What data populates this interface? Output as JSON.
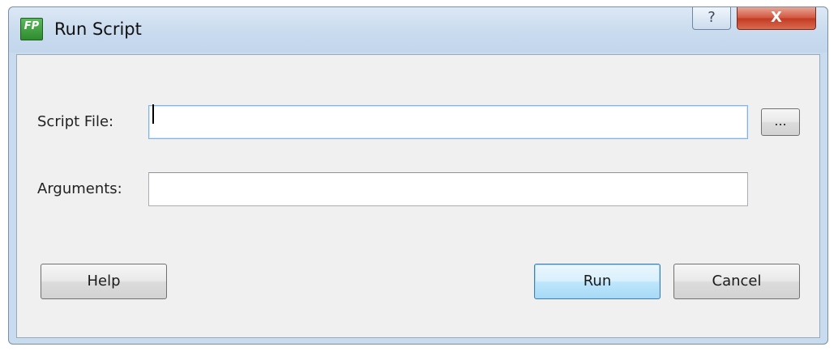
{
  "window": {
    "title": "Run Script",
    "app_icon": {
      "name": "fp-app-icon",
      "text": "FP"
    },
    "help_glyph": "?",
    "close_glyph": "X"
  },
  "form": {
    "script_file": {
      "label": "Script File:",
      "value": "",
      "browse_label": "..."
    },
    "arguments": {
      "label": "Arguments:",
      "value": ""
    }
  },
  "buttons": {
    "help": "Help",
    "run": "Run",
    "cancel": "Cancel"
  },
  "colors": {
    "titlebar": "#c8daee",
    "close_button": "#c94a33",
    "default_button_border": "#3c7fb1"
  }
}
